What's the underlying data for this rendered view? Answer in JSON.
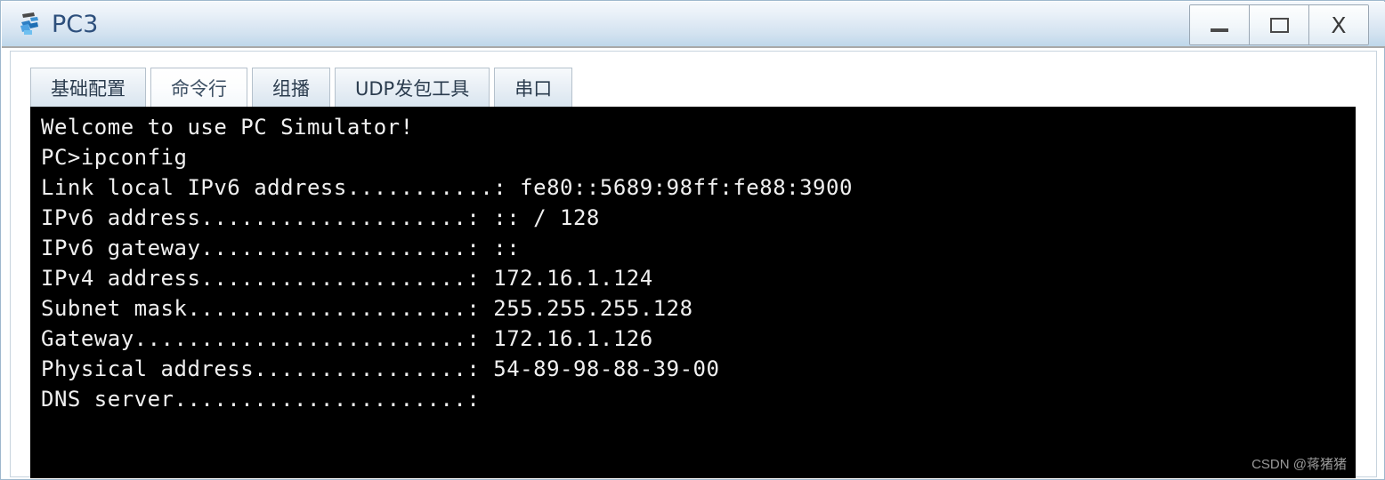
{
  "window": {
    "title": "PC3",
    "icon": "pc-device-icon",
    "controls": [
      {
        "name": "minimize",
        "label": "—"
      },
      {
        "name": "maximize",
        "label": "❐"
      },
      {
        "name": "close",
        "label": "X"
      }
    ]
  },
  "tabs": [
    {
      "label": "基础配置",
      "selected": false,
      "name": "tab-basic-config"
    },
    {
      "label": "命令行",
      "selected": true,
      "name": "tab-command-line"
    },
    {
      "label": "组播",
      "selected": false,
      "name": "tab-multicast"
    },
    {
      "label": "UDP发包工具",
      "selected": false,
      "name": "tab-udp-tool"
    },
    {
      "label": "串口",
      "selected": false,
      "name": "tab-serial-port"
    }
  ],
  "terminal": {
    "lines": [
      "Welcome to use PC Simulator!",
      "",
      "PC>ipconfig",
      "",
      "Link local IPv6 address...........: fe80::5689:98ff:fe88:3900",
      "IPv6 address....................: :: / 128",
      "IPv6 gateway....................: ::",
      "IPv4 address....................: 172.16.1.124",
      "Subnet mask.....................: 255.255.255.128",
      "Gateway.........................: 172.16.1.126",
      "Physical address................: 54-89-98-88-39-00",
      "DNS server......................:"
    ],
    "values": {
      "link_local_ipv6": "fe80::5689:98ff:fe88:3900",
      "ipv6_address": ":: / 128",
      "ipv6_gateway": "::",
      "ipv4_address": "172.16.1.124",
      "subnet_mask": "255.255.255.128",
      "gateway": "172.16.1.126",
      "physical_address": "54-89-98-88-39-00",
      "dns_server": "",
      "prompt": "PC>",
      "command": "ipconfig",
      "banner": "Welcome to use PC Simulator!"
    },
    "background_color": "#000000",
    "text_color": "#f0f0f0"
  },
  "watermark": "CSDN @蒋猪猪"
}
